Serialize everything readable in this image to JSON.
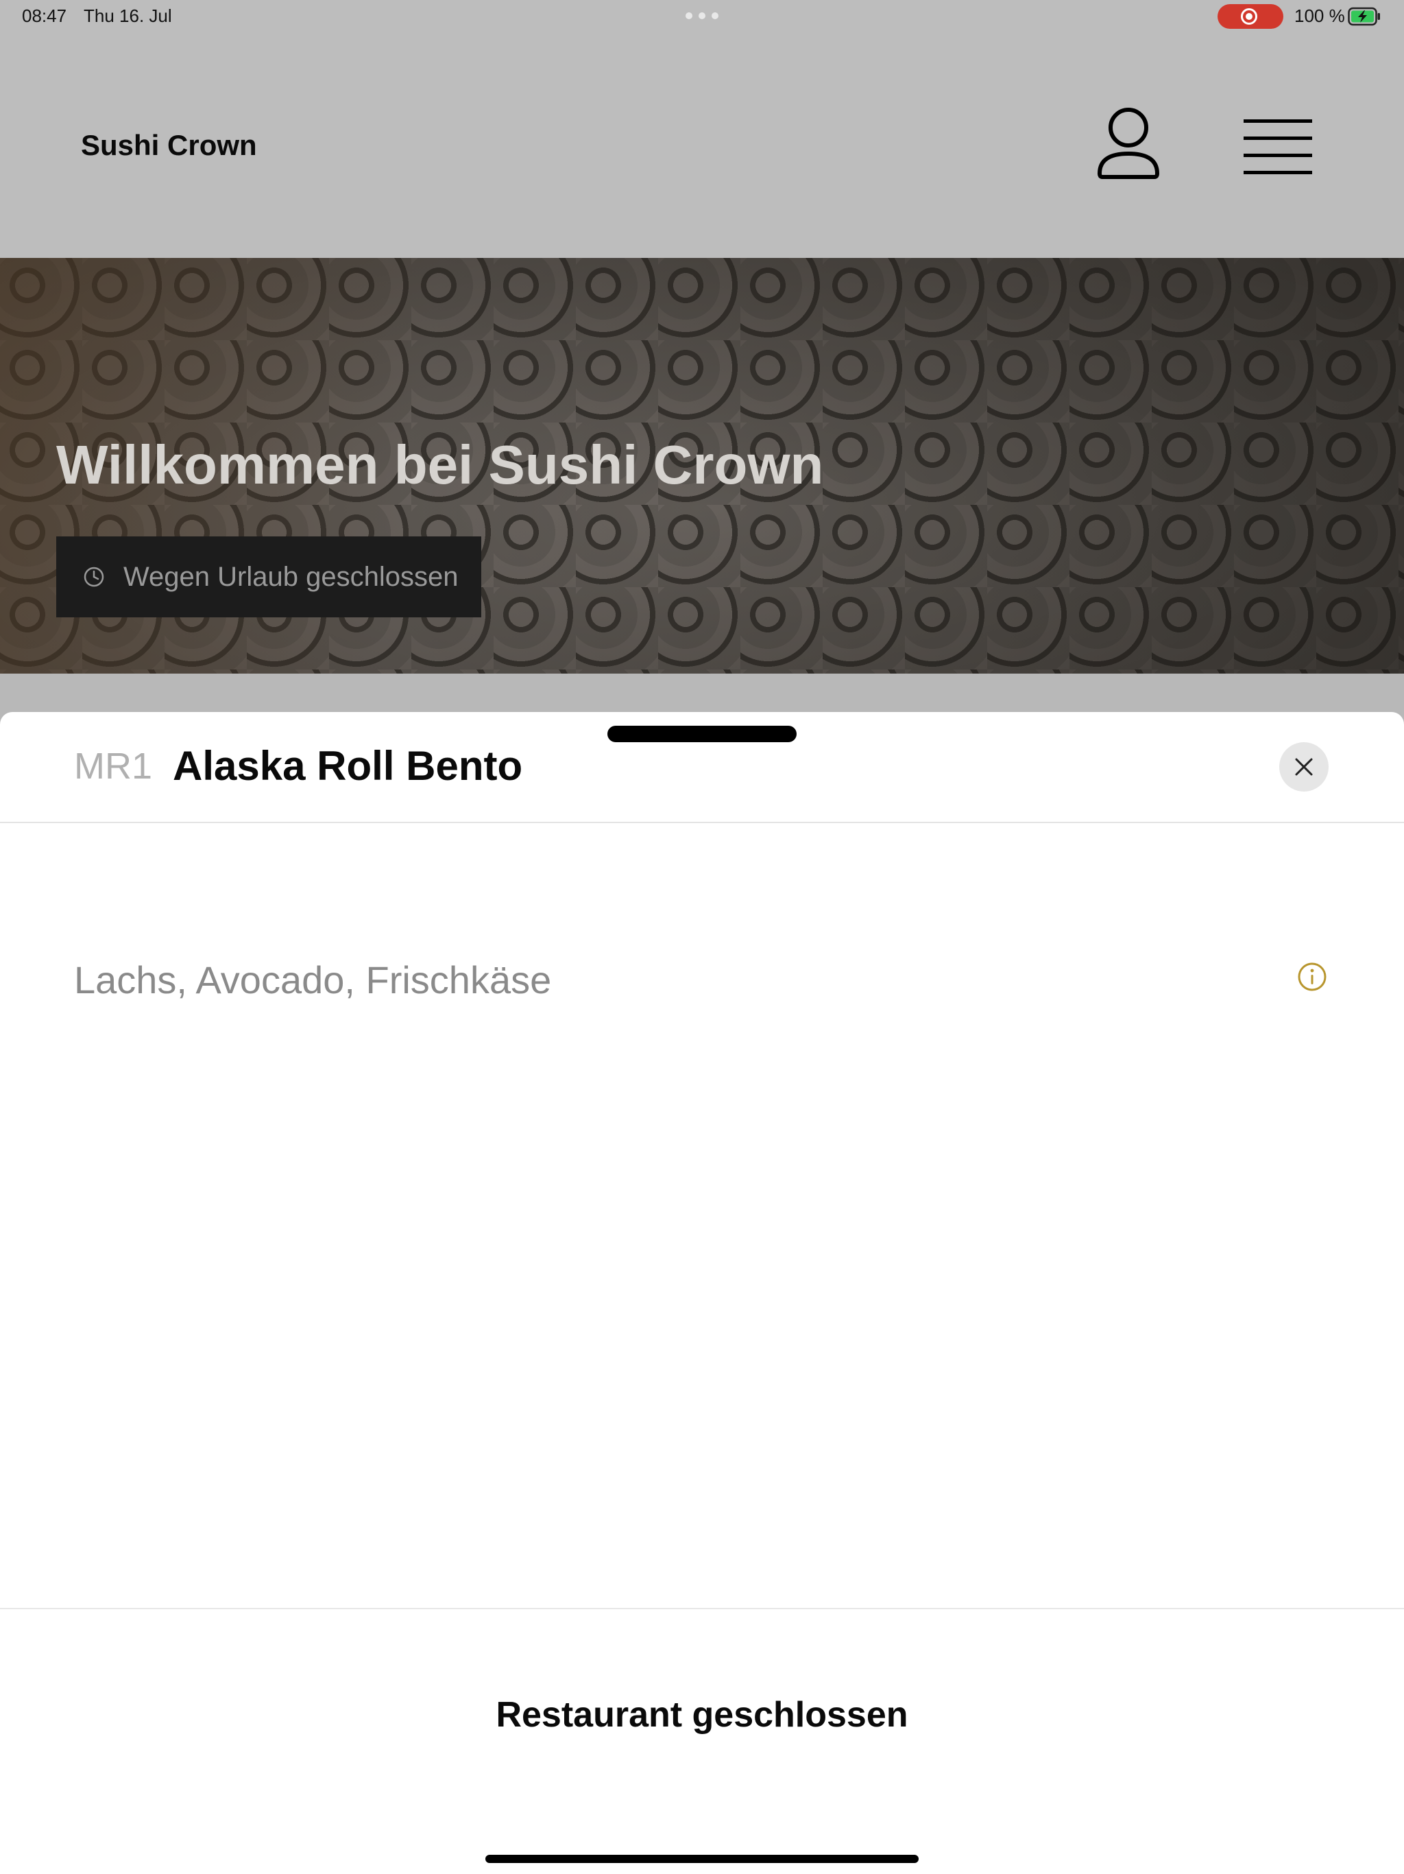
{
  "status_bar": {
    "time": "08:47",
    "date": "Thu 16. Jul",
    "battery_percent": "100 %",
    "recording_color": "#d1382c",
    "battery_charging_color": "#34c759"
  },
  "header": {
    "brand": "Sushi Crown",
    "account_icon": "user-icon",
    "menu_icon": "hamburger-menu-icon"
  },
  "hero": {
    "title": "Willkommen bei Sushi Crown",
    "status_text": "Wegen Urlaub geschlossen",
    "status_icon": "clock-icon"
  },
  "product_sheet": {
    "code": "MR1",
    "name": "Alaska Roll Bento",
    "description": "Lachs, Avocado, Frischkäse",
    "info_icon_color": "#b8962e",
    "footer_status": "Restaurant geschlossen"
  }
}
